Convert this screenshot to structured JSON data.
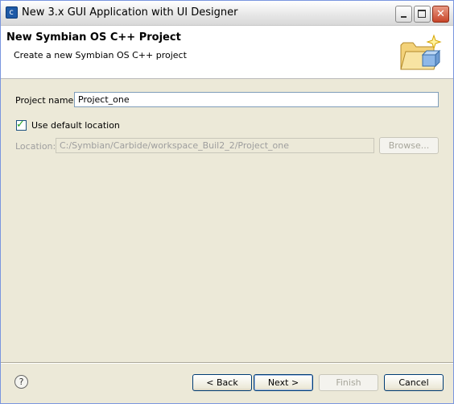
{
  "window": {
    "title": "New 3.x GUI Application with UI Designer",
    "app_icon_glyph": "c"
  },
  "header": {
    "title": "New Symbian OS C++ Project",
    "description": "Create a new Symbian OS C++ project",
    "graphic_icon": "folder-sparkle-icon"
  },
  "form": {
    "project_name_label": "Project name:",
    "project_name_value": "Project_one",
    "use_default_label": "Use default location",
    "use_default_checked": true,
    "location_label": "Location:",
    "location_value": "C:/Symbian/Carbide/workspace_Buil2_2/Project_one",
    "browse_label": "Browse..."
  },
  "footer": {
    "help_glyph": "?",
    "back_label": "< Back",
    "next_label": "Next >",
    "finish_label": "Finish",
    "cancel_label": "Cancel"
  },
  "colors": {
    "dialog_bg": "#ece9d8",
    "header_bg": "#ffffff",
    "check_green": "#21a121"
  }
}
